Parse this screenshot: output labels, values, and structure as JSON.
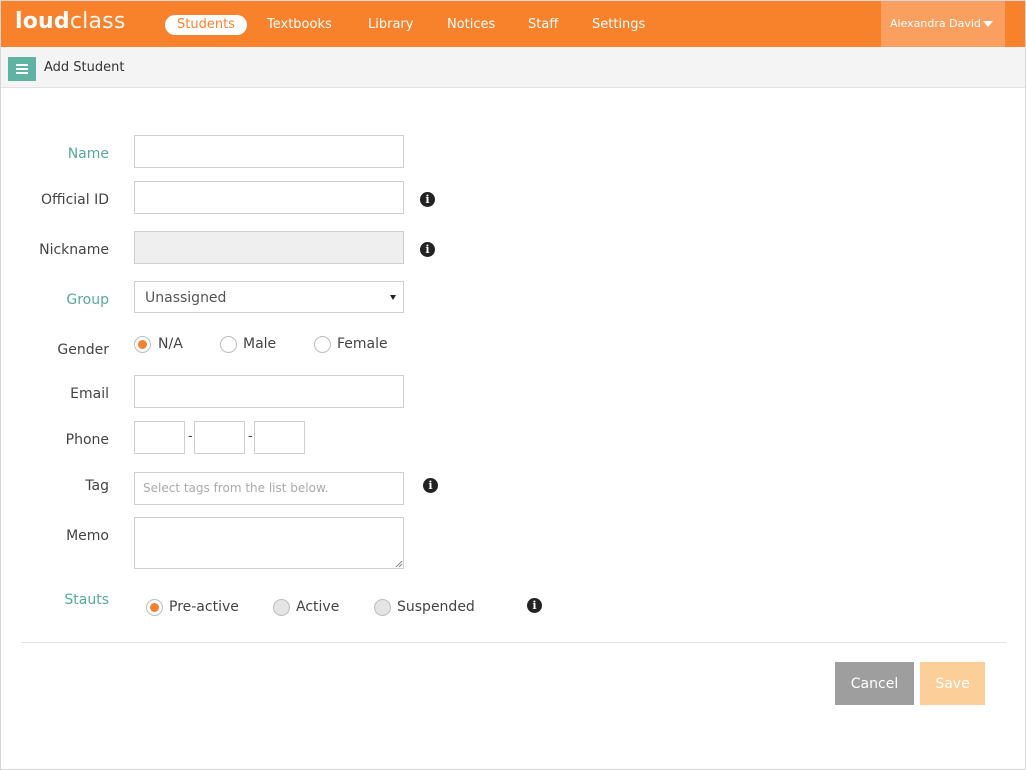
{
  "nav": {
    "logo_bold": "loud",
    "logo_light": "class",
    "items": [
      {
        "label": "Students",
        "active": true
      },
      {
        "label": "Textbooks"
      },
      {
        "label": "Library"
      },
      {
        "label": "Notices"
      },
      {
        "label": "Staff"
      },
      {
        "label": "Settings"
      }
    ],
    "user": "Alexandra David"
  },
  "subheader": {
    "title": "Add Student",
    "menu_icon": "hamburger-menu-icon"
  },
  "form": {
    "name": {
      "label": "Name",
      "value": ""
    },
    "official_id": {
      "label": "Official ID",
      "value": ""
    },
    "nickname": {
      "label": "Nickname",
      "value": ""
    },
    "group": {
      "label": "Group",
      "selected": "Unassigned"
    },
    "gender": {
      "label": "Gender",
      "options": [
        "N/A",
        "Male",
        "Female"
      ],
      "selected": "N/A"
    },
    "email": {
      "label": "Email",
      "value": ""
    },
    "phone": {
      "label": "Phone",
      "separator": "-"
    },
    "tag": {
      "label": "Tag",
      "placeholder": "Select tags from the list below."
    },
    "memo": {
      "label": "Memo",
      "value": ""
    },
    "status": {
      "label": "Stauts",
      "options": [
        "Pre-active",
        "Active",
        "Suspended"
      ],
      "selected": "Pre-active"
    }
  },
  "actions": {
    "cancel": "Cancel",
    "save": "Save"
  },
  "icons": {
    "info": "i"
  },
  "colors": {
    "brand": "#f8822c",
    "teal": "#55aa9a",
    "cancel": "#9e9e9e",
    "save_disabled": "#fccf98"
  }
}
